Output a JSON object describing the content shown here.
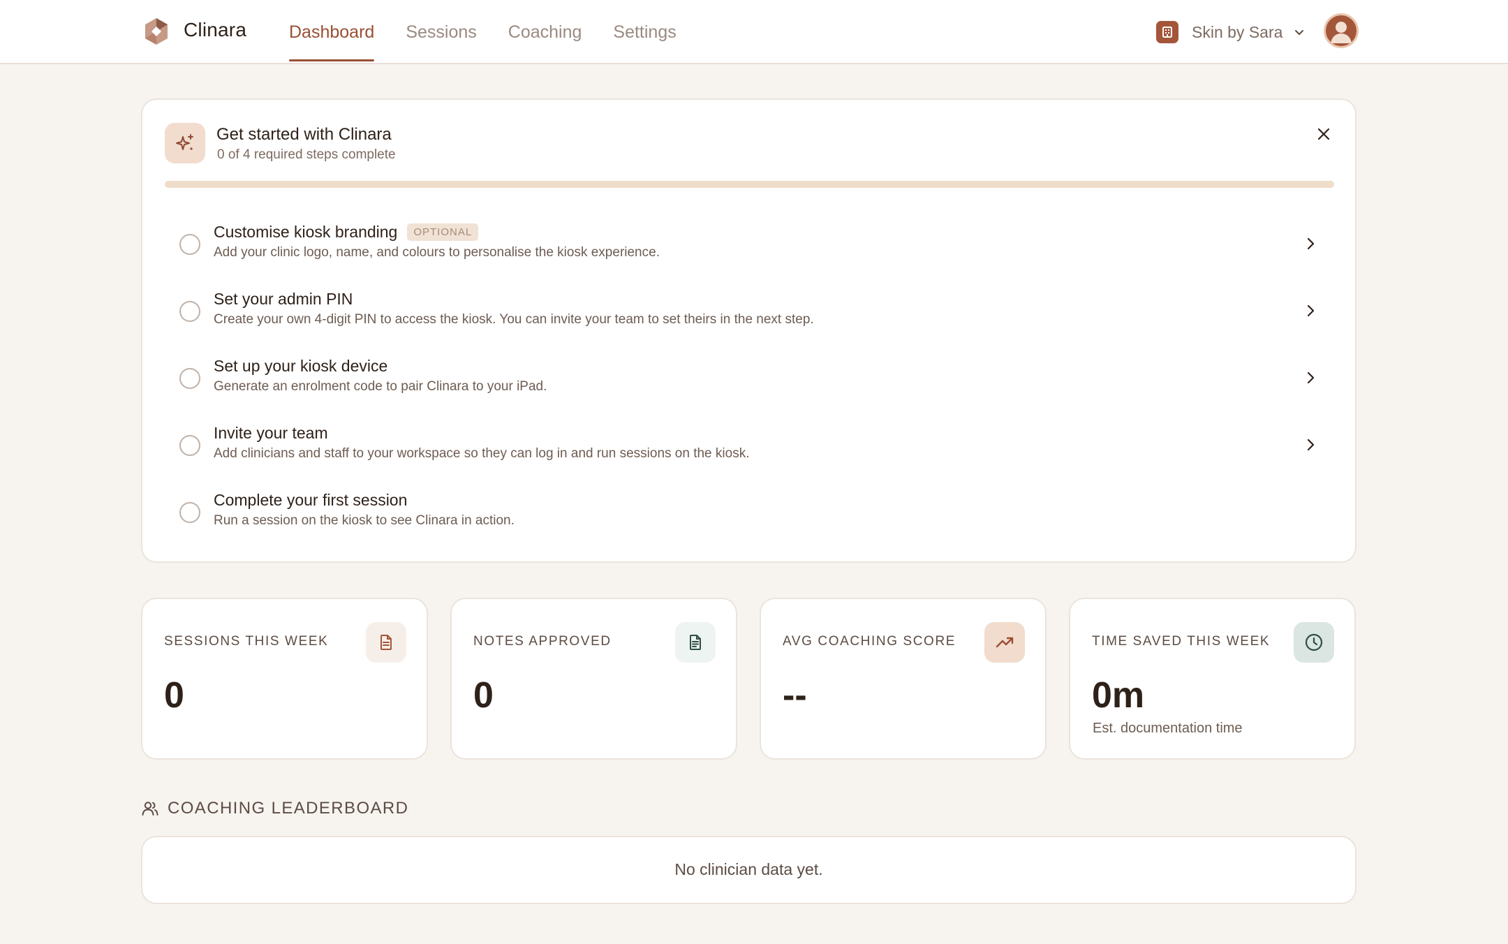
{
  "app": {
    "name": "Clinara"
  },
  "nav": {
    "tabs": [
      {
        "label": "Dashboard",
        "active": true
      },
      {
        "label": "Sessions",
        "active": false
      },
      {
        "label": "Coaching",
        "active": false
      },
      {
        "label": "Settings",
        "active": false
      }
    ]
  },
  "clinic": {
    "name": "Skin by Sara"
  },
  "onboarding": {
    "title": "Get started with Clinara",
    "subtitle": "0 of 4 required steps complete",
    "progress": 0,
    "steps": [
      {
        "title": "Customise kiosk branding",
        "badge": "OPTIONAL",
        "description": "Add your clinic logo, name, and colours to personalise the kiosk experience.",
        "has_arrow": true
      },
      {
        "title": "Set your admin PIN",
        "description": "Create your own 4-digit PIN to access the kiosk. You can invite your team to set theirs in the next step.",
        "has_arrow": true
      },
      {
        "title": "Set up your kiosk device",
        "description": "Generate an enrolment code to pair Clinara to your iPad.",
        "has_arrow": true
      },
      {
        "title": "Invite your team",
        "description": "Add clinicians and staff to your workspace so they can log in and run sessions on the kiosk.",
        "has_arrow": true
      },
      {
        "title": "Complete your first session",
        "description": "Run a session on the kiosk to see Clinara in action.",
        "has_arrow": false
      }
    ]
  },
  "stats": [
    {
      "label": "SESSIONS THIS WEEK",
      "value": "0",
      "icon": "document-icon",
      "icon_color": "#a4563a",
      "icon_bg": "#f6efe9"
    },
    {
      "label": "NOTES APPROVED",
      "value": "0",
      "icon": "file-text-icon",
      "icon_color": "#2f4d45",
      "icon_bg": "#eef4f1"
    },
    {
      "label": "AVG COACHING SCORE",
      "value": "--",
      "icon": "trending-up-icon",
      "icon_color": "#9a4f33",
      "icon_bg": "#f1dccd"
    },
    {
      "label": "TIME SAVED THIS WEEK",
      "value": "0m",
      "note": "Est. documentation time",
      "icon": "clock-icon",
      "icon_color": "#2f4d45",
      "icon_bg": "#dbe5e1"
    }
  ],
  "leaderboard": {
    "title": "COACHING LEADERBOARD",
    "empty_text": "No clinician data yet."
  },
  "colors": {
    "accent": "#a4563a",
    "background": "#f7f4f0",
    "card": "#ffffff"
  }
}
